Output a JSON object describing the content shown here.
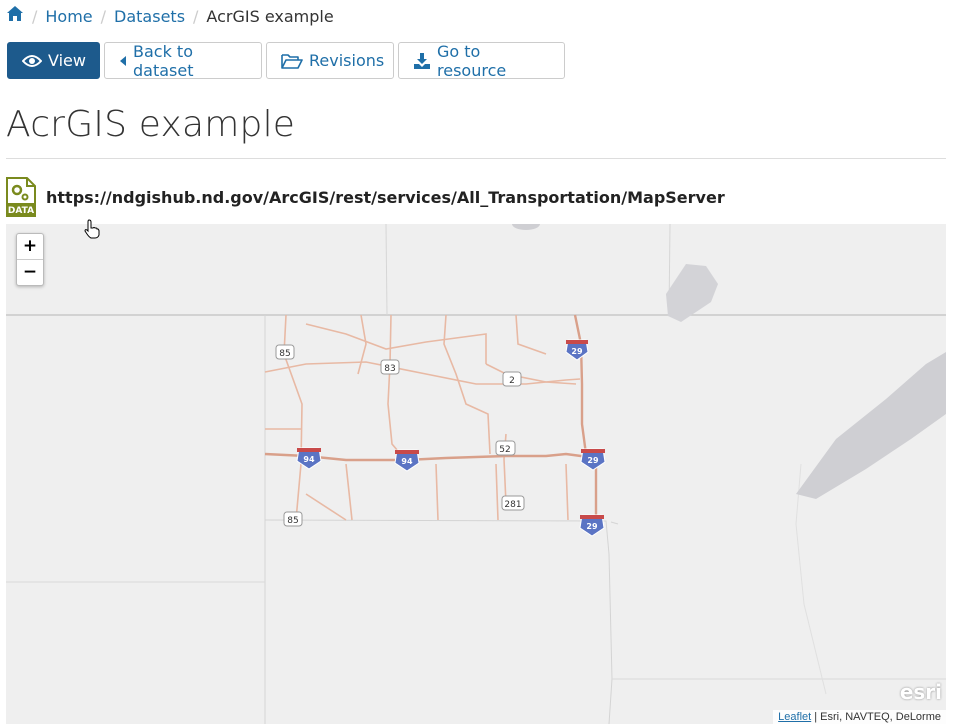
{
  "breadcrumb": {
    "home_icon": "home-icon",
    "items": [
      "Home",
      "Datasets"
    ],
    "current": "AcrGIS example"
  },
  "toolbar": {
    "view": "View",
    "back": "Back to dataset",
    "revisions": "Revisions",
    "go_to_resource": "Go to resource"
  },
  "page": {
    "title": "AcrGIS example"
  },
  "resource": {
    "icon_label": "DATA",
    "url": "https://ndgishub.nd.gov/ArcGIS/rest/services/All_Transportation/MapServer"
  },
  "map": {
    "zoom_in": "+",
    "zoom_out": "−",
    "logo": "esri",
    "attribution_link": "Leaflet",
    "attribution_text": " | Esri, NAVTEQ, DeLorme",
    "shields": {
      "i29_a": "29",
      "i29_b": "29",
      "i29_c": "29",
      "i94_a": "94",
      "i94_b": "94",
      "us85_a": "85",
      "us85_b": "85",
      "us83": "83",
      "us2": "2",
      "us52": "52",
      "us281": "281"
    }
  },
  "colors": {
    "link": "#1f6fa8",
    "primary_button": "#1d5a8c",
    "data_icon": "#7a8a1e",
    "road": "#e8b9a4",
    "interstate": "#d9a08a",
    "water": "#cfcfd3",
    "land": "#efefef"
  }
}
